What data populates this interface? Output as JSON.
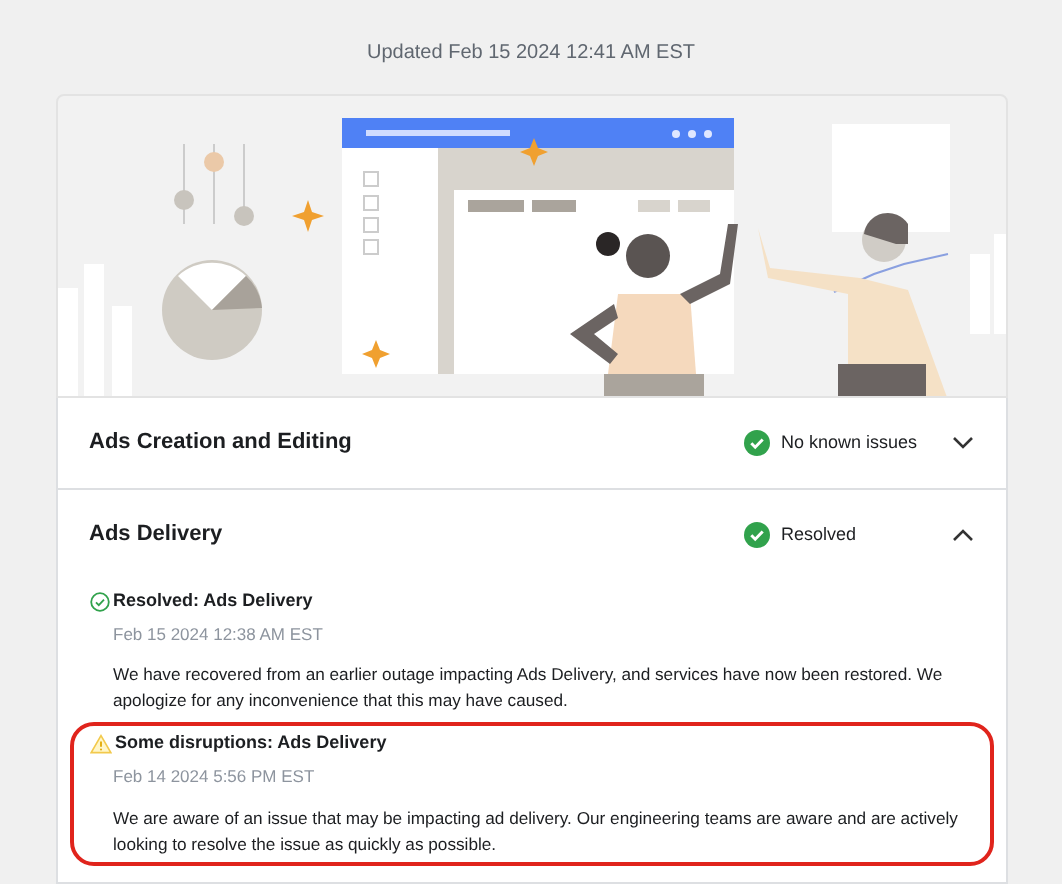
{
  "page": {
    "updated": "Updated Feb 15 2024 12:41 AM EST"
  },
  "components": [
    {
      "name": "Ads Creation and Editing",
      "kind": "ok",
      "status": "No known issues",
      "expanded": false
    },
    {
      "name": "Ads Delivery",
      "kind": "ok",
      "status": "Resolved",
      "expanded": true,
      "updates": [
        {
          "kind": "resolved",
          "title": "Resolved: Ads Delivery",
          "time": "Feb 15 2024 12:38 AM EST",
          "body": "We have recovered from an earlier outage impacting Ads Delivery, and services have now been restored. We apologize for any inconvenience that this may have caused.",
          "highlighted": false
        },
        {
          "kind": "disruption",
          "title": "Some disruptions: Ads Delivery",
          "time": "Feb 14 2024 5:56 PM EST",
          "body": "We are aware of an issue that may be impacting ad delivery. Our engineering teams are aware and are actively looking to resolve the issue as quickly as possible.",
          "highlighted": true
        }
      ]
    }
  ]
}
